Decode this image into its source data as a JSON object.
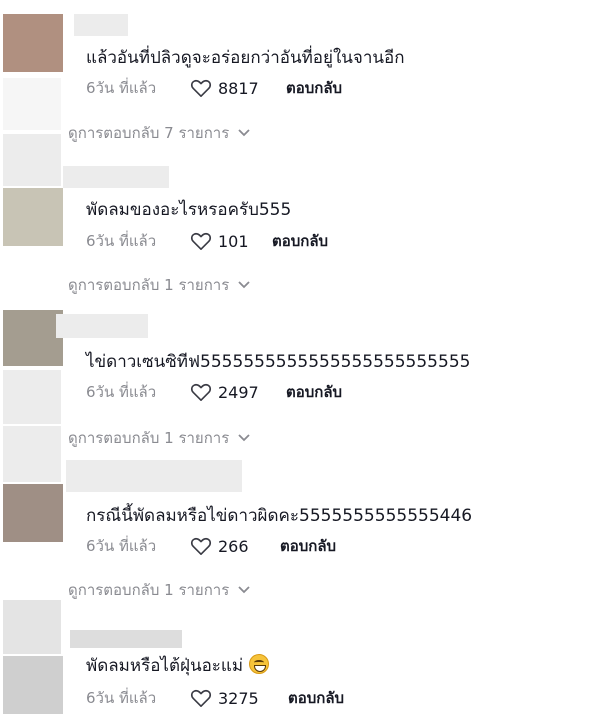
{
  "comments": [
    {
      "text": "แล้วอันที่ปลิวดูจะอร่อยกว่าอันที่อยู่ในจานอีก",
      "time": "6วัน ที่แล้ว",
      "likes": "8817",
      "reply_label": "ตอบกลับ",
      "view_replies": "ดูการตอบกลับ 7 รายการ",
      "avatar_color": "#b09080"
    },
    {
      "text": "พัดลมของอะไรหรอครับ555",
      "time": "6วัน ที่แล้ว",
      "likes": "101",
      "reply_label": "ตอบกลับ",
      "view_replies": "ดูการตอบกลับ 1 รายการ",
      "avatar_color": "#c8c4b5"
    },
    {
      "text": "ไข่ดาวเซนซิทีฟ5555555555555555555555555",
      "time": "6วัน ที่แล้ว",
      "likes": "2497",
      "reply_label": "ตอบกลับ",
      "view_replies": "ดูการตอบกลับ 1 รายการ",
      "avatar_color": "#a49d90"
    },
    {
      "text": "กรณีนี้พัดลมหรือไข่ดาวผิดคะ5555555555555446",
      "time": "6วัน ที่แล้ว",
      "likes": "266",
      "reply_label": "ตอบกลับ",
      "view_replies": "ดูการตอบกลับ 1 รายการ",
      "avatar_color": "#9f8f85"
    },
    {
      "text": "พัดลมหรือไต้ฝุ่นอะแม่",
      "time": "6วัน ที่แล้ว",
      "likes": "3275",
      "reply_label": "ตอบกลับ",
      "avatar_color": "#cfcfcf"
    }
  ],
  "icons": {
    "like": "heart-outline-icon",
    "expand": "chevron-down-icon",
    "emoji": "grinning-squinting-face-emoji"
  },
  "colors": {
    "text": "#161823",
    "muted": "#8a8b91",
    "placeholder_light": "#ececec",
    "placeholder_mid": "#dddddd"
  }
}
